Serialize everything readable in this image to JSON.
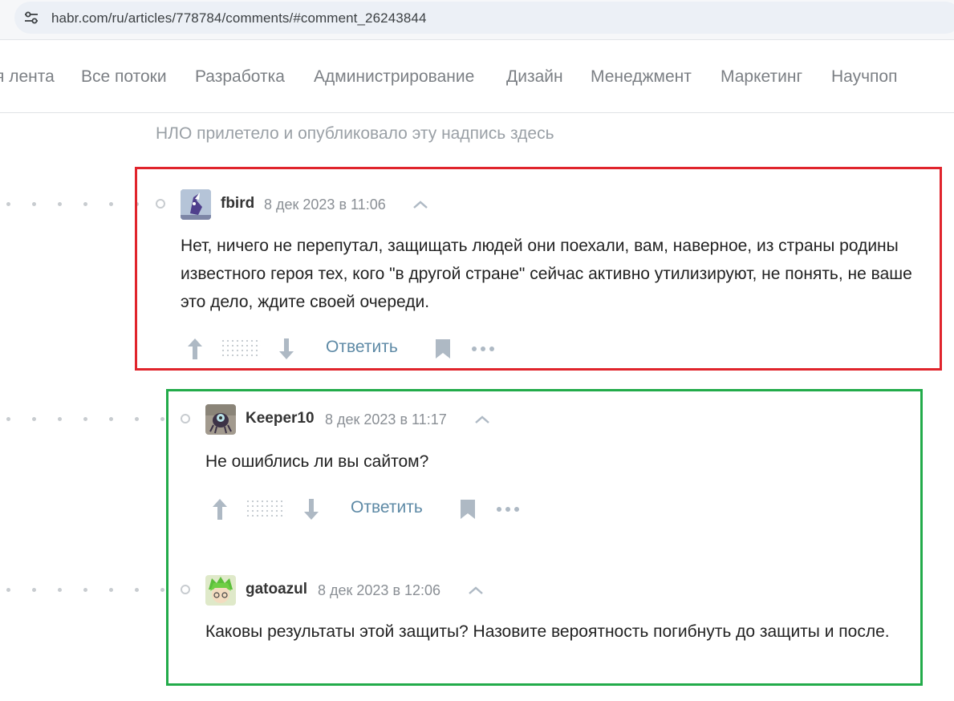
{
  "browser": {
    "url": "habr.com/ru/articles/778784/comments/#comment_26243844"
  },
  "nav": {
    "items": [
      "я лента",
      "Все потоки",
      "Разработка",
      "Администрирование",
      "Дизайн",
      "Менеджмент",
      "Маркетинг",
      "Научпоп"
    ]
  },
  "ufo_message": "НЛО прилетело и опубликовало эту надпись здесь",
  "comments": [
    {
      "username": "fbird",
      "date": "8 дек 2023 в 11:06",
      "text": "Нет, ничего не перепутал, защищать людей они поехали, вам, наверное, из страны родины известного героя тех, кого \"в другой стране\" сейчас активно утилизируют, не понять, не ваше это дело, ждите своей очереди.",
      "reply_label": "Ответить"
    },
    {
      "username": "Keeper10",
      "date": "8 дек 2023 в 11:17",
      "text": "Не ошиблись ли вы сайтом?",
      "reply_label": "Ответить"
    },
    {
      "username": "gatoazul",
      "date": "8 дек 2023 в 12:06",
      "text": "Каковы результаты этой защиты? Назовите вероятность погибнуть до защиты и после."
    }
  ],
  "colors": {
    "highlight_red": "#e0242c",
    "highlight_green": "#22ab4a",
    "reply_link": "#5e8aa6"
  }
}
